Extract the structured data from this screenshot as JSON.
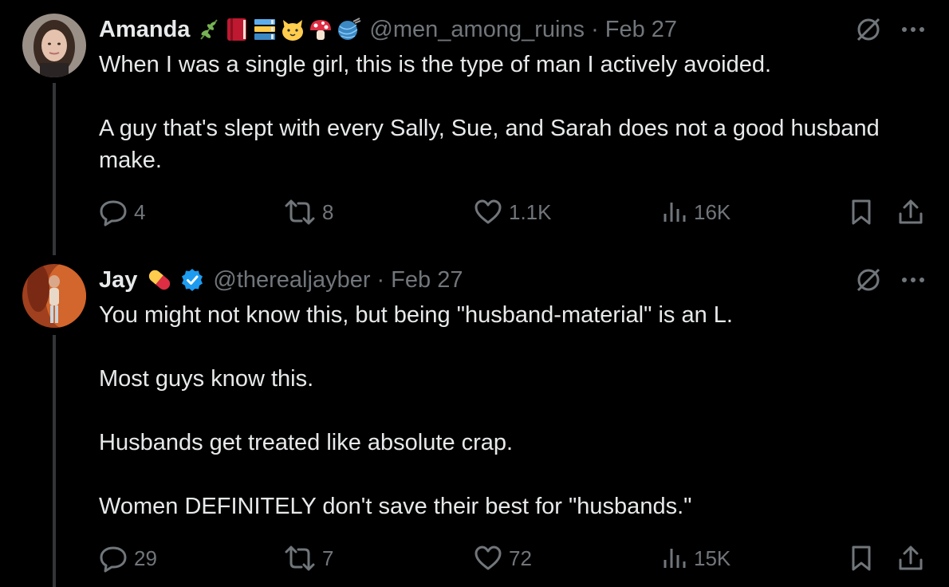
{
  "tweets": [
    {
      "name": "Amanda",
      "emojis": [
        "herb",
        "closed-book",
        "books",
        "cat-face",
        "mushroom",
        "yarn"
      ],
      "handle": "@men_among_ruins",
      "sep": "·",
      "date": "Feb 27",
      "paragraphs": [
        "When I was a single girl, this is the type of man I actively avoided.",
        "A guy that's slept with every Sally, Sue, and Sarah does not a good husband make."
      ],
      "stats": {
        "replies": "4",
        "reposts": "8",
        "likes": "1.1K",
        "views": "16K"
      }
    },
    {
      "name": "Jay",
      "emojis": [
        "pill"
      ],
      "verified": true,
      "handle": "@therealjayber",
      "sep": "·",
      "date": "Feb 27",
      "paragraphs": [
        "You might not know this, but being \"husband-material\" is an L.",
        "Most guys know this.",
        "Husbands get treated like absolute crap.",
        "Women DEFINITELY don't save their best for \"husbands.\""
      ],
      "stats": {
        "replies": "29",
        "reposts": "7",
        "likes": "72",
        "views": "15K"
      }
    }
  ],
  "colors": {
    "text": "#e7e9ea",
    "muted": "#71767b",
    "verified": "#1d9bf0",
    "background": "#000000"
  }
}
